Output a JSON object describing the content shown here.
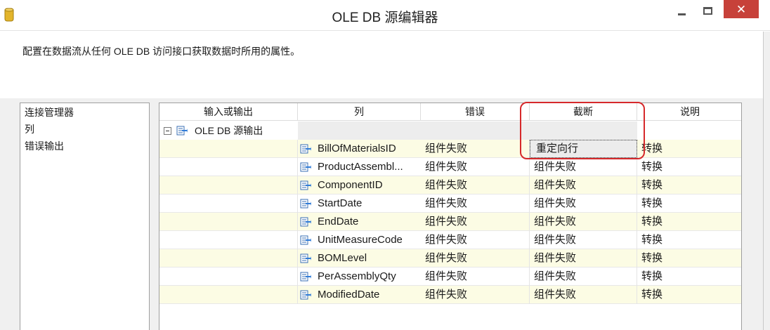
{
  "window": {
    "title": "OLE DB 源编辑器",
    "close_label": "✕"
  },
  "description": "配置在数据流从任何 OLE DB 访问接口获取数据时所用的属性。",
  "nav": {
    "items": [
      {
        "label": "连接管理器"
      },
      {
        "label": "列"
      },
      {
        "label": "错误输出"
      }
    ]
  },
  "grid": {
    "headers": {
      "io": "输入或输出",
      "column": "列",
      "error": "错误",
      "truncation": "截断",
      "description": "说明"
    },
    "parent_label": "OLE DB 源输出",
    "rows": [
      {
        "column": "BillOfMaterialsID",
        "error": "组件失败",
        "truncation": "重定向行",
        "description": "转换"
      },
      {
        "column": "ProductAssembl...",
        "error": "组件失败",
        "truncation": "组件失败",
        "description": "转换"
      },
      {
        "column": "ComponentID",
        "error": "组件失败",
        "truncation": "组件失败",
        "description": "转换"
      },
      {
        "column": "StartDate",
        "error": "组件失败",
        "truncation": "组件失败",
        "description": "转换"
      },
      {
        "column": "EndDate",
        "error": "组件失败",
        "truncation": "组件失败",
        "description": "转换"
      },
      {
        "column": "UnitMeasureCode",
        "error": "组件失败",
        "truncation": "组件失败",
        "description": "转换"
      },
      {
        "column": "BOMLevel",
        "error": "组件失败",
        "truncation": "组件失败",
        "description": "转换"
      },
      {
        "column": "PerAssemblyQty",
        "error": "组件失败",
        "truncation": "组件失败",
        "description": "转换"
      },
      {
        "column": "ModifiedDate",
        "error": "组件失败",
        "truncation": "组件失败",
        "description": "转换"
      }
    ]
  },
  "colors": {
    "highlight": "#d6292b",
    "alt_row": "#fcfce4",
    "close_button": "#c7413a"
  }
}
